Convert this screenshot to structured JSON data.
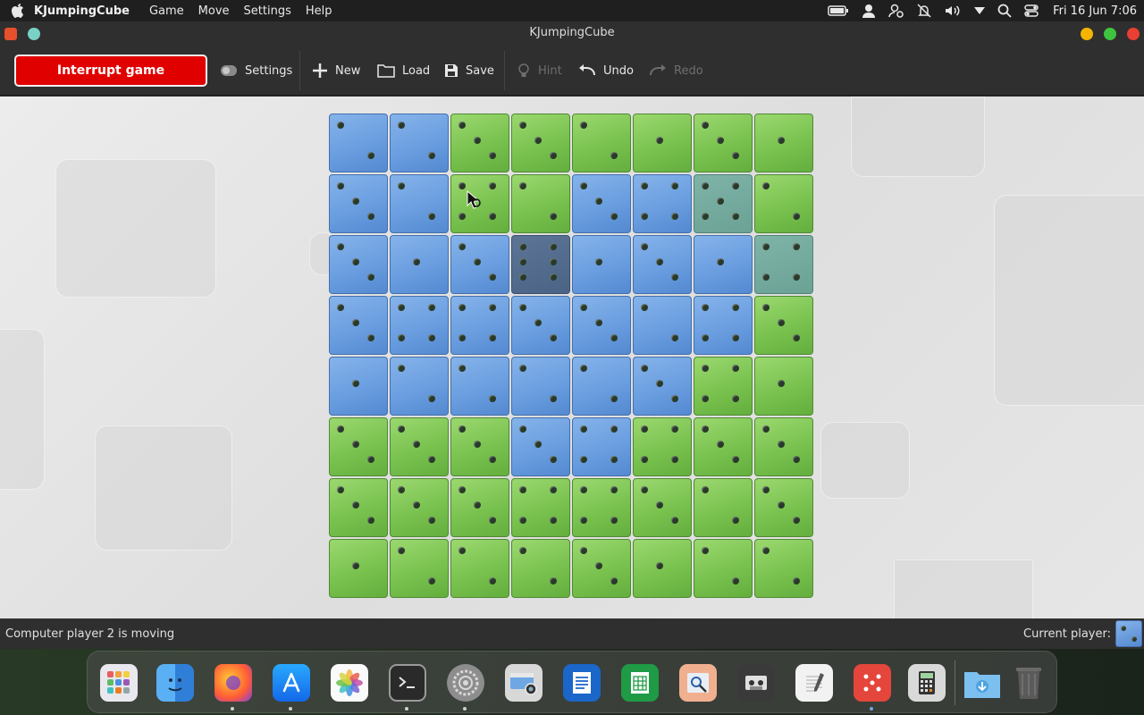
{
  "menubar": {
    "app_name": "KJumpingCube",
    "menus": [
      "Game",
      "Move",
      "Settings",
      "Help"
    ],
    "clock": "Fri 16 Jun 7:06"
  },
  "window": {
    "title": "KJumpingCube"
  },
  "toolbar": {
    "interrupt_label": "Interrupt game",
    "settings_label": "Settings",
    "new_label": "New",
    "load_label": "Load",
    "save_label": "Save",
    "hint_label": "Hint",
    "undo_label": "Undo",
    "redo_label": "Redo"
  },
  "board": {
    "rows": 8,
    "cols": 8,
    "cells": [
      [
        "blue:2",
        "blue:2",
        "green:3",
        "green:3",
        "green:2",
        "green:1",
        "green:3",
        "green:1"
      ],
      [
        "blue:3",
        "blue:2",
        "green:4",
        "green:2",
        "blue:3",
        "blue:4",
        "teal:5",
        "green:2"
      ],
      [
        "blue:3",
        "blue:1",
        "blue:3",
        "dark:6",
        "blue:1",
        "blue:3",
        "blue:1",
        "teal:4"
      ],
      [
        "blue:3",
        "blue:4",
        "blue:4",
        "blue:3",
        "blue:3",
        "blue:2",
        "blue:4",
        "green:3"
      ],
      [
        "blue:1",
        "blue:2",
        "blue:2",
        "blue:2",
        "blue:2",
        "blue:3",
        "green:4",
        "green:1"
      ],
      [
        "green:3",
        "green:3",
        "green:3",
        "blue:3",
        "blue:4",
        "green:4",
        "green:3",
        "green:3"
      ],
      [
        "green:3",
        "green:3",
        "green:3",
        "green:4",
        "green:4",
        "green:3",
        "green:2",
        "green:3"
      ],
      [
        "green:1",
        "green:2",
        "green:2",
        "green:2",
        "green:3",
        "green:1",
        "green:2",
        "green:2"
      ]
    ]
  },
  "status": {
    "message": "Computer player 2 is moving",
    "current_player_label": "Current player:"
  },
  "dock": {
    "items": [
      "launchpad-icon",
      "finder-icon",
      "firefox-icon",
      "app-store-icon",
      "photos-icon",
      "terminal-icon",
      "system-settings-icon",
      "screenshot-icon",
      "text-editor-icon",
      "spreadsheet-icon",
      "image-viewer-icon",
      "cassette-icon",
      "notes-icon",
      "dice-game-icon",
      "calculator-icon",
      "downloads-folder-icon",
      "trash-icon"
    ]
  }
}
